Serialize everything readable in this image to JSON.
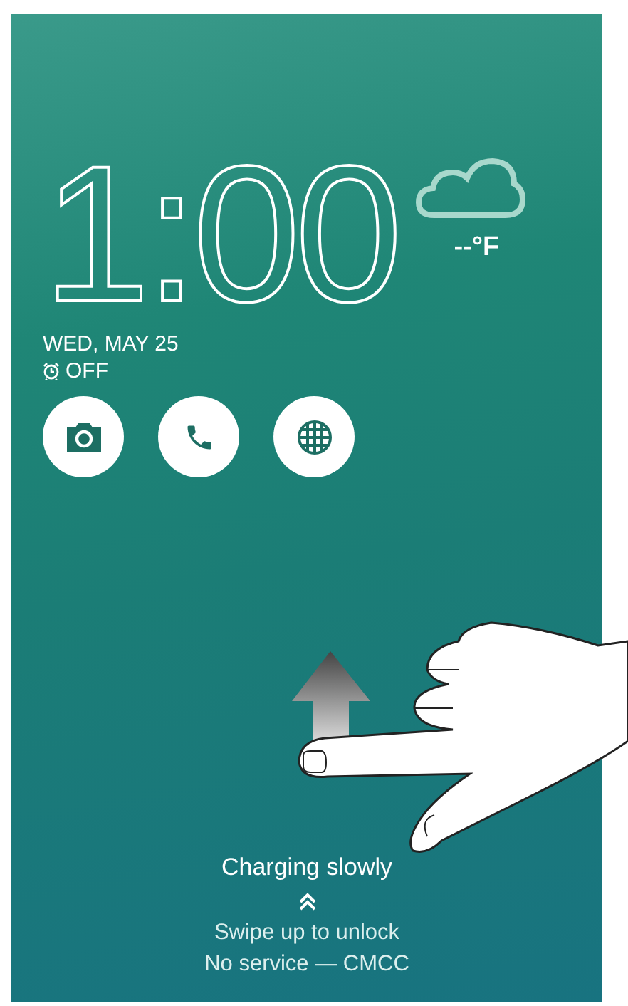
{
  "clock": {
    "time": "1:00"
  },
  "weather": {
    "temperature": "--°F"
  },
  "date": "WED, MAY 25",
  "alarm": {
    "label": "OFF"
  },
  "status_text": "Charging slowly",
  "unlock_hint": "Swipe up to unlock",
  "carrier": "No service — CMCC"
}
